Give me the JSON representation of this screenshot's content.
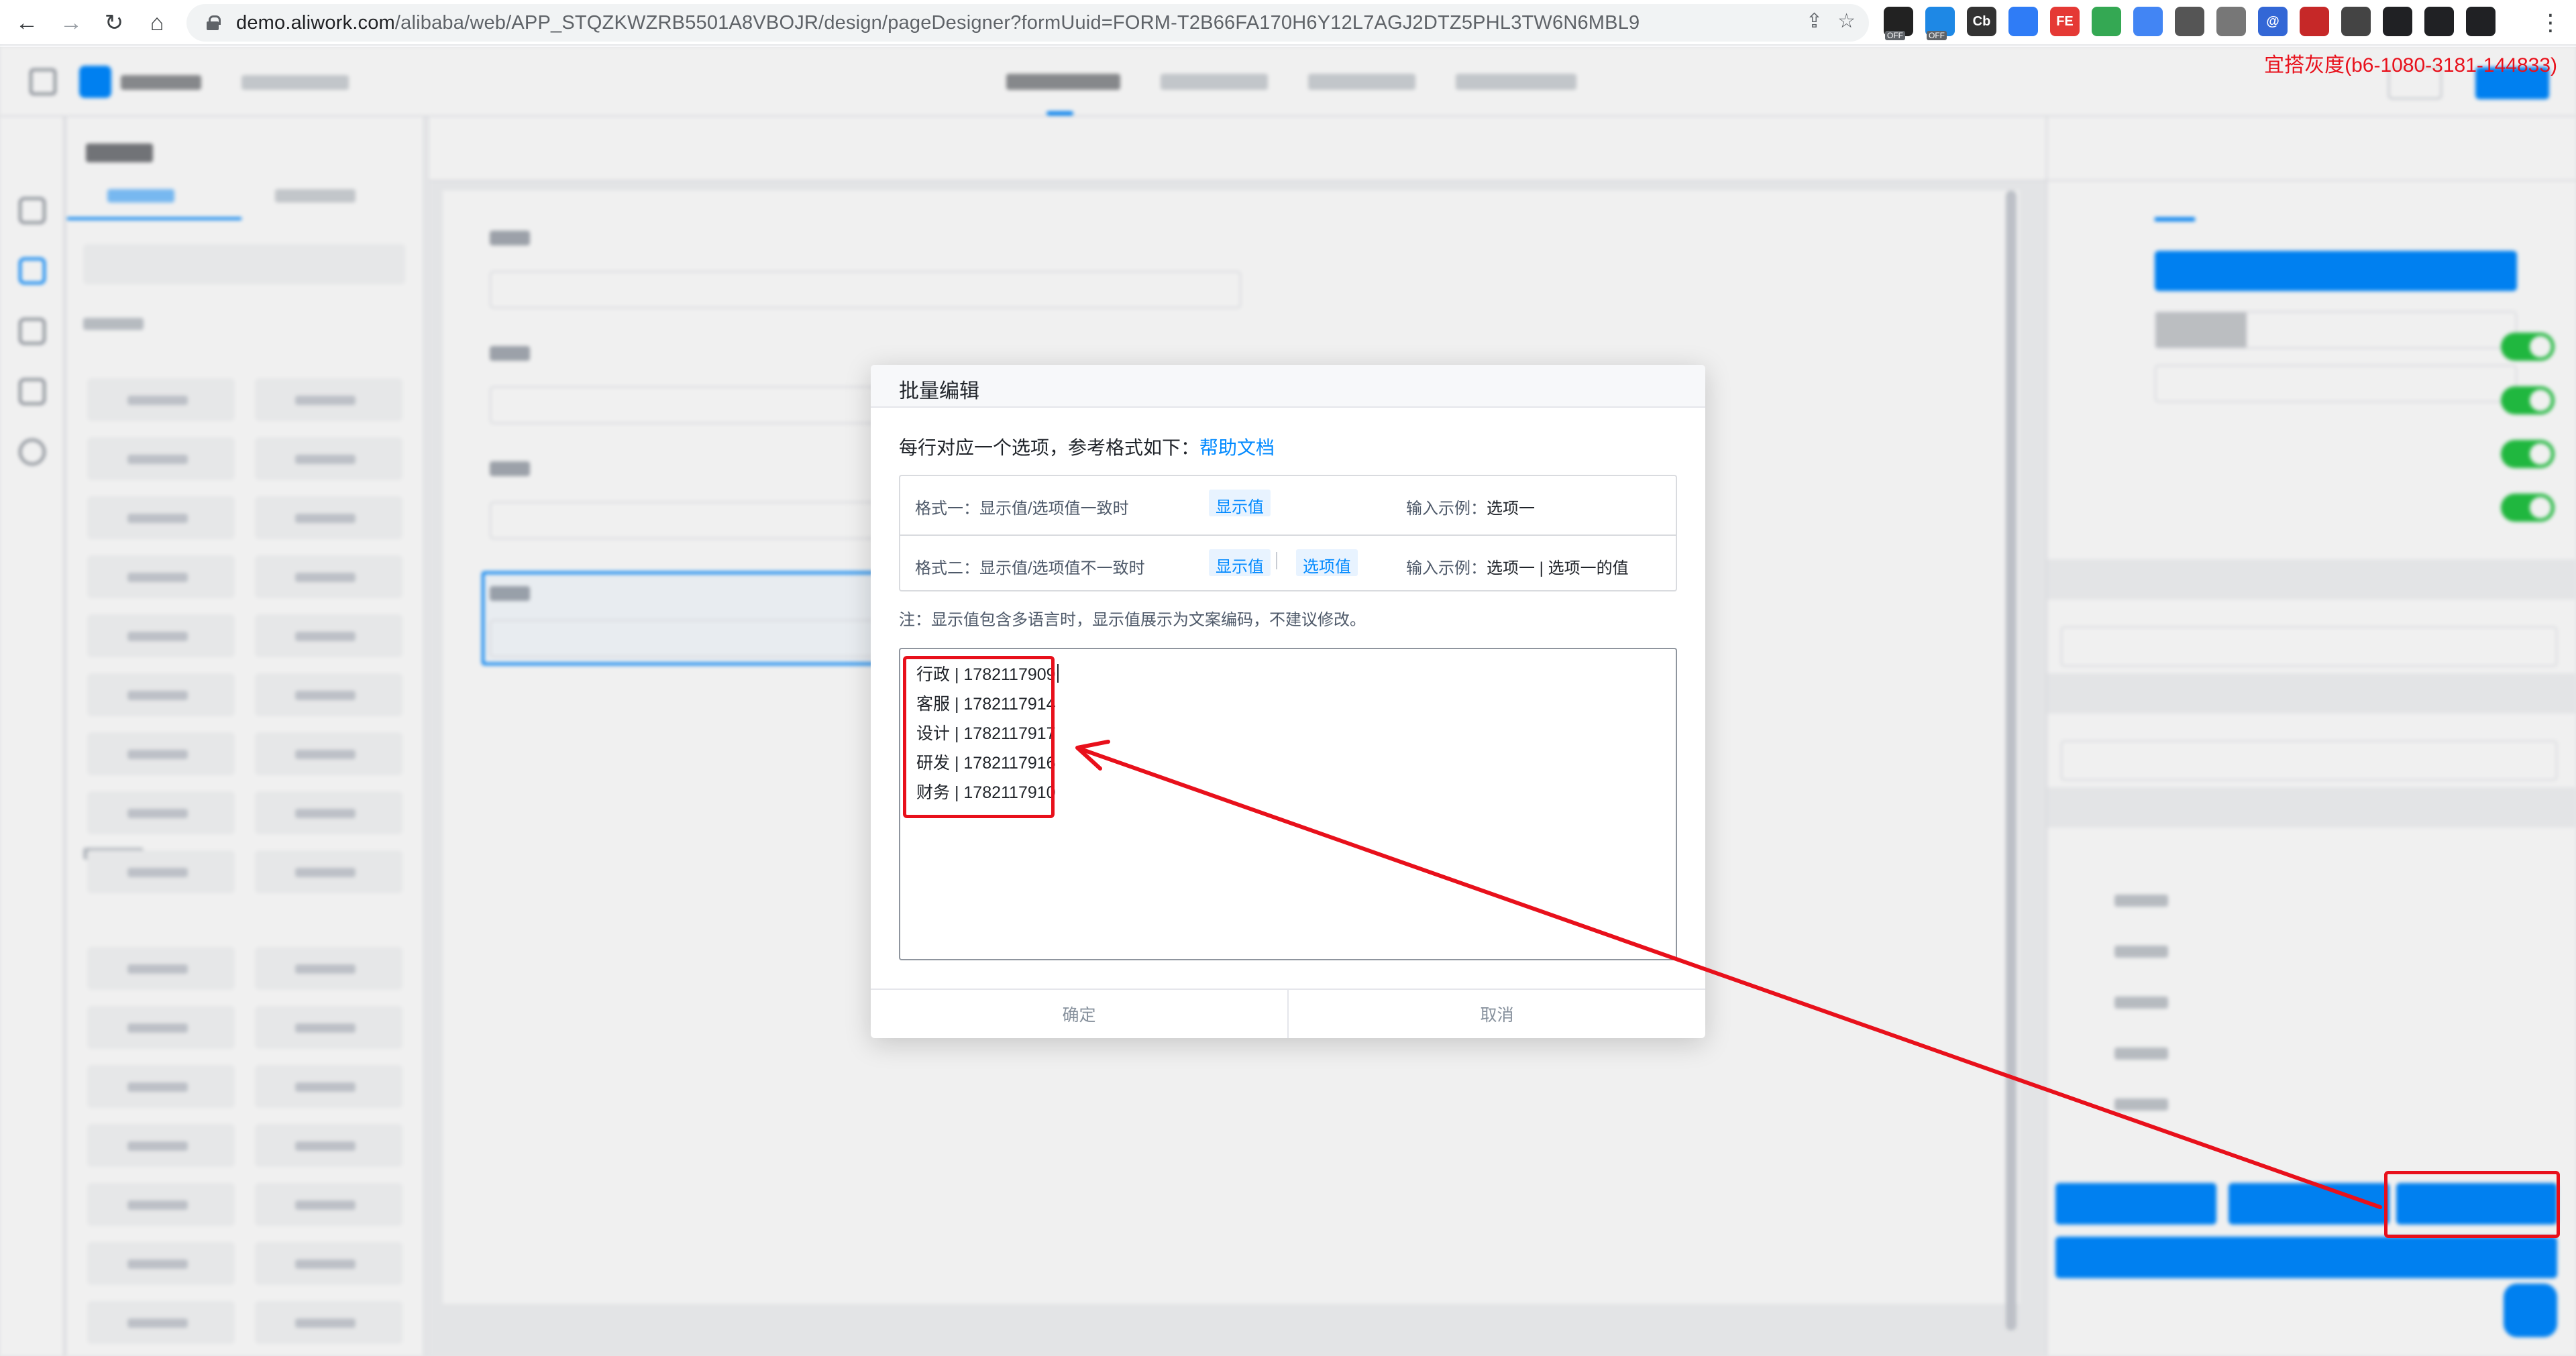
{
  "browser": {
    "url_host": "demo.aliwork.com",
    "url_path": "/alibaba/web/APP_STQZKWZRB5501A8VBOJR/design/pageDesigner?formUuid=FORM-T2B66FA170H6Y12L7AGJ2DTZ5PHL3TW6N6MBL9",
    "back_icon": "←",
    "forward_icon": "→",
    "reload_icon": "↻",
    "home_icon": "⌂",
    "share_icon": "⇪",
    "star_icon": "☆",
    "extensions": [
      {
        "name": "ext-1",
        "label": "",
        "color": "#222222",
        "off_badge": "OFF"
      },
      {
        "name": "ext-2",
        "label": "",
        "color": "#1e88e5",
        "off_badge": "OFF"
      },
      {
        "name": "ext-3",
        "label": "Cb",
        "color": "#333333",
        "off_badge": ""
      },
      {
        "name": "ext-4",
        "label": "",
        "color": "#2f7cf6",
        "off_badge": ""
      },
      {
        "name": "ext-5",
        "label": "FE",
        "color": "#e53935",
        "off_badge": ""
      },
      {
        "name": "ext-6",
        "label": "",
        "color": "#34a853",
        "off_badge": ""
      },
      {
        "name": "ext-7",
        "label": "",
        "color": "#4285f4",
        "off_badge": ""
      },
      {
        "name": "ext-8",
        "label": "",
        "color": "#555555",
        "off_badge": ""
      },
      {
        "name": "ext-9",
        "label": "",
        "color": "#777777",
        "off_badge": ""
      },
      {
        "name": "ext-10",
        "label": "@",
        "color": "#3367d6",
        "off_badge": ""
      },
      {
        "name": "ext-11",
        "label": "",
        "color": "#c62828",
        "off_badge": ""
      },
      {
        "name": "ext-12",
        "label": "",
        "color": "#444444",
        "off_badge": ""
      },
      {
        "name": "ext-13",
        "label": "",
        "color": "#202124",
        "off_badge": ""
      },
      {
        "name": "ext-14",
        "label": "",
        "color": "#202124",
        "off_badge": ""
      },
      {
        "name": "ext-15",
        "label": "",
        "color": "#202124",
        "off_badge": ""
      }
    ],
    "menu_icon": "⋮"
  },
  "env_note": "宜搭灰度(b6-1080-3181-144833)",
  "dialog": {
    "title": "批量编辑",
    "intro_text": "每行对应一个选项，参考格式如下：",
    "help_link": "帮助文档",
    "formats": [
      {
        "desc": "格式一：显示值/选项值一致时",
        "tags": [
          "显示值"
        ],
        "example_label": "输入示例：",
        "example_value": "选项一"
      },
      {
        "desc": "格式二：显示值/选项值不一致时",
        "tags": [
          "显示值",
          "选项值"
        ],
        "example_label": "输入示例：",
        "example_value": "选项一 | 选项一的值"
      }
    ],
    "note": "注：显示值包含多语言时，显示值展示为文案编码，不建议修改。",
    "textarea_lines": [
      "行政 | 1782117909",
      "客服 | 1782117914",
      "设计 | 1782117917",
      "研发 | 1782117916",
      "财务 | 1782117910"
    ],
    "confirm": "确定",
    "cancel": "取消"
  },
  "colors": {
    "annotation": "#e8101b",
    "accent": "#0089ff",
    "toggle_on": "#23c343"
  }
}
